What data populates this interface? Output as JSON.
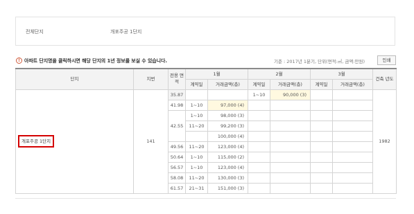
{
  "filter": {
    "label": "전체단지",
    "value": "개포주공 1단지"
  },
  "notice": {
    "icon": "!",
    "text": "아파트 단지명을 클릭하시면 해당 단지의 1년 정보를 보실 수 있습니다.",
    "criteria": "기준 : 2017년 1분기, 단위(면적:㎡, 금액:만원)",
    "print_label": "인쇄"
  },
  "table": {
    "headers": {
      "complex": "단지",
      "lot": "지번",
      "area": "전용 면적",
      "months": [
        "1월",
        "2월",
        "3월"
      ],
      "contract_day": "계약일",
      "amount": "거래금액(층)",
      "built_year": "건축 년도"
    },
    "complex_name": "개포주공 1단지",
    "lot_number": "141",
    "built_year": "1982",
    "rows": [
      {
        "area": "35.87",
        "m1_day": "",
        "m1_amt": "",
        "m2_day": "1~10",
        "m2_amt": "90,000 (3)",
        "m3_day": "",
        "m3_amt": ""
      },
      {
        "area": "41.98",
        "m1_day": "1~10",
        "m1_amt": "97,000 (4)",
        "m2_day": "",
        "m2_amt": "",
        "m3_day": "",
        "m3_amt": ""
      },
      {
        "area": "42.55",
        "m1_day": "1~10",
        "m1_amt": "98,000 (3)",
        "m2_day": "",
        "m2_amt": "",
        "m3_day": "",
        "m3_amt": ""
      },
      {
        "area": "",
        "m1_day": "11~20",
        "m1_amt": "99,200 (3)",
        "m2_day": "",
        "m2_amt": "",
        "m3_day": "",
        "m3_amt": ""
      },
      {
        "area": "",
        "m1_day": "",
        "m1_amt": "100,000 (4)",
        "m2_day": "",
        "m2_amt": "",
        "m3_day": "",
        "m3_amt": ""
      },
      {
        "area": "49.56",
        "m1_day": "11~20",
        "m1_amt": "123,000 (4)",
        "m2_day": "",
        "m2_amt": "",
        "m3_day": "",
        "m3_amt": ""
      },
      {
        "area": "50.64",
        "m1_day": "1~10",
        "m1_amt": "115,000 (2)",
        "m2_day": "",
        "m2_amt": "",
        "m3_day": "",
        "m3_amt": ""
      },
      {
        "area": "56.57",
        "m1_day": "1~10",
        "m1_amt": "123,000 (4)",
        "m2_day": "",
        "m2_amt": "",
        "m3_day": "",
        "m3_amt": ""
      },
      {
        "area": "58.08",
        "m1_day": "11~20",
        "m1_amt": "130,000 (3)",
        "m2_day": "",
        "m2_amt": "",
        "m3_day": "",
        "m3_amt": ""
      },
      {
        "area": "61.57",
        "m1_day": "21~31",
        "m1_amt": "151,000 (3)",
        "m2_day": "",
        "m2_amt": "",
        "m3_day": "",
        "m3_amt": ""
      }
    ]
  },
  "colors": {
    "highlight_border": "#d40000",
    "notice_icon": "#d05a3a",
    "amount_highlight_bg": "#fff9e0"
  }
}
